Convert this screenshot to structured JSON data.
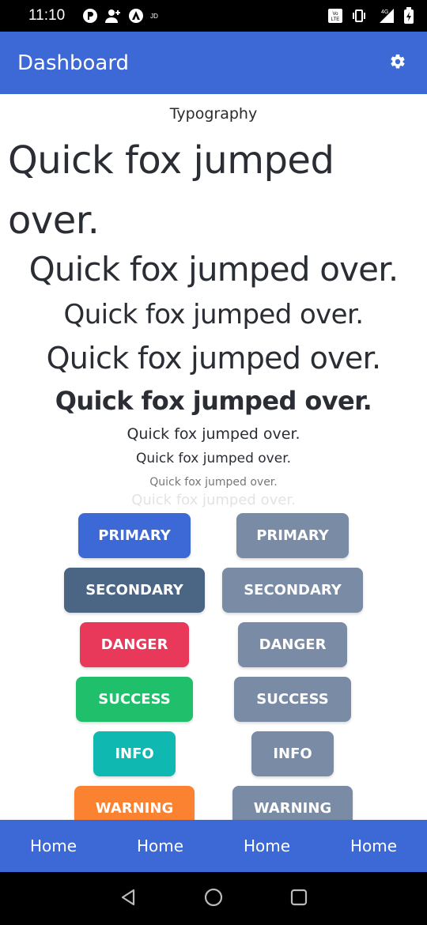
{
  "status_bar": {
    "time": "11:10",
    "small_label": "JD",
    "lte_label": "Vo LTE",
    "network_label": "4G"
  },
  "app_bar": {
    "title": "Dashboard",
    "settings_icon": "gear-icon"
  },
  "typography": {
    "title": "Typography",
    "samples": [
      "Quick fox jumped over.",
      "Quick fox jumped over.",
      "Quick fox jumped over.",
      "Quick fox jumped over.",
      "Quick fox jumped over.",
      "Quick fox jumped over.",
      "Quick fox jumped over.",
      "Quick fox jumped over.",
      "Quick fox jumped over."
    ]
  },
  "buttons": {
    "rows": [
      {
        "filled": {
          "label": "PRIMARY",
          "color": "#3c69d6"
        },
        "muted": {
          "label": "PRIMARY",
          "color": "#7a8ba6"
        }
      },
      {
        "filled": {
          "label": "SECONDARY",
          "color": "#4b6584"
        },
        "muted": {
          "label": "SECONDARY",
          "color": "#7a8ba6"
        }
      },
      {
        "filled": {
          "label": "DANGER",
          "color": "#e8395a"
        },
        "muted": {
          "label": "DANGER",
          "color": "#7a8ba6"
        }
      },
      {
        "filled": {
          "label": "SUCCESS",
          "color": "#20bf6b"
        },
        "muted": {
          "label": "SUCCESS",
          "color": "#7a8ba6"
        }
      },
      {
        "filled": {
          "label": "INFO",
          "color": "#0fb9b1"
        },
        "muted": {
          "label": "INFO",
          "color": "#7a8ba6"
        }
      },
      {
        "filled": {
          "label": "WARNING",
          "color": "#fa8231"
        },
        "muted": {
          "label": "WARNING",
          "color": "#7a8ba6"
        }
      }
    ]
  },
  "bottom_nav": {
    "items": [
      "Home",
      "Home",
      "Home",
      "Home"
    ]
  },
  "system_nav": {
    "back_icon": "triangle-back-icon",
    "home_icon": "circle-home-icon",
    "recents_icon": "square-recents-icon"
  }
}
